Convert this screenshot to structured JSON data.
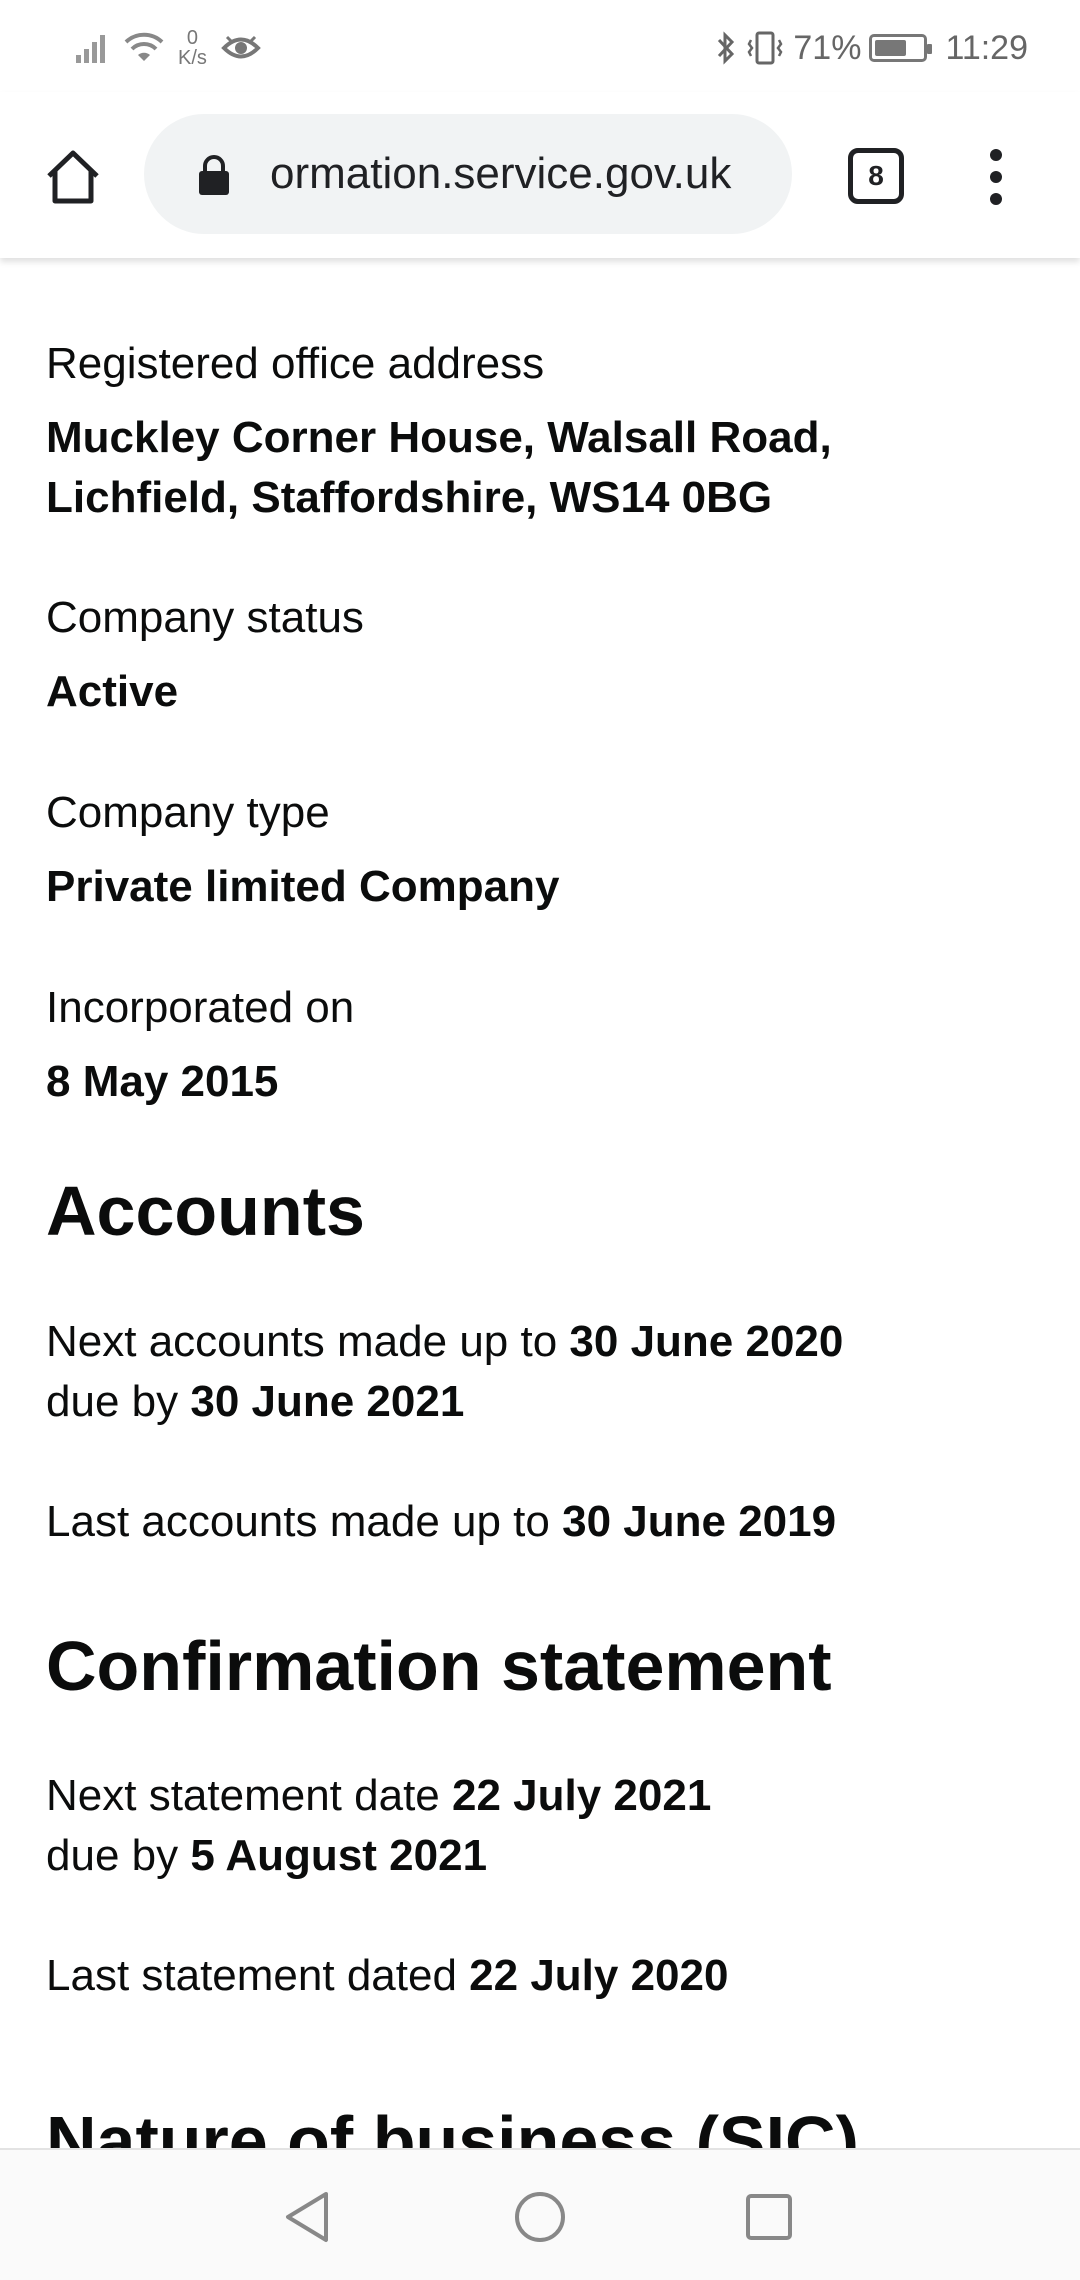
{
  "status_bar": {
    "net_speed_value": "0",
    "net_speed_unit": "K/s",
    "battery_percent": "71%",
    "battery_level": 0.71,
    "time": "11:29"
  },
  "browser": {
    "url": "ormation.service.gov.uk",
    "tab_count": "8"
  },
  "company": {
    "registered_office_label": "Registered office address",
    "registered_office_line1": "Muckley Corner House, Walsall Road,",
    "registered_office_line2": "Lichfield, Staffordshire, WS14 0BG",
    "status_label": "Company status",
    "status_value": "Active",
    "type_label": "Company type",
    "type_value": "Private limited Company",
    "incorporated_label": "Incorporated on",
    "incorporated_value": "8 May 2015"
  },
  "accounts": {
    "heading": "Accounts",
    "next_prefix": "Next accounts made up to ",
    "next_date": "30 June 2020",
    "due_prefix": "due by ",
    "due_date": "30 June 2021",
    "last_prefix": "Last accounts made up to ",
    "last_date": "30 June 2019"
  },
  "confirmation": {
    "heading": "Confirmation statement",
    "next_prefix": "Next statement date ",
    "next_date": "22 July 2021",
    "due_prefix": "due by ",
    "due_date": "5 August 2021",
    "last_prefix": "Last statement dated ",
    "last_date": "22 July 2020"
  },
  "next_section": {
    "heading": "Nature of business (SIC)"
  }
}
